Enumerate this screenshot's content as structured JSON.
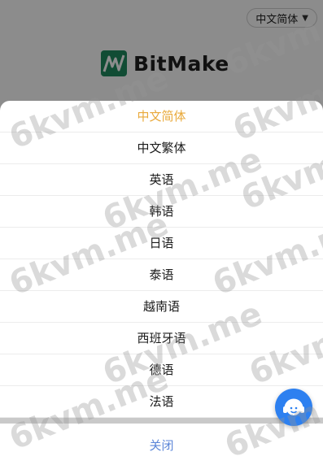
{
  "header": {
    "language_selector": "中文简体",
    "logo_text": "BitMake"
  },
  "language_sheet": {
    "options": [
      {
        "label": "中文简体",
        "active": true
      },
      {
        "label": "中文繁体",
        "active": false
      },
      {
        "label": "英语",
        "active": false
      },
      {
        "label": "韩语",
        "active": false
      },
      {
        "label": "日语",
        "active": false
      },
      {
        "label": "泰语",
        "active": false
      },
      {
        "label": "越南语",
        "active": false
      },
      {
        "label": "西班牙语",
        "active": false
      },
      {
        "label": "德语",
        "active": false
      },
      {
        "label": "法语",
        "active": false
      }
    ],
    "close_label": "关闭"
  },
  "watermark": "6kvm.me",
  "colors": {
    "active_option": "#e9a93a",
    "close_text": "#5c86d8",
    "brand_green": "#1f8a5f",
    "support_button": "#2d80f0"
  },
  "icons": {
    "language_caret": "caret-down-icon",
    "logo": "bitmake-logo-icon",
    "support": "customer-service-headset-icon"
  }
}
